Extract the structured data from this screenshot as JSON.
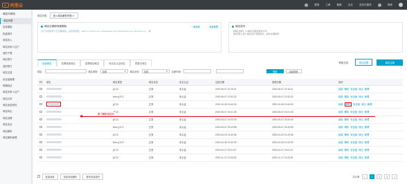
{
  "logo": {
    "text": "阿里云"
  },
  "topnav": [
    "费用",
    "工单",
    "备案",
    "企业",
    "支持与服务",
    "简体"
  ],
  "sidebar": {
    "header": "域名与网站",
    "items": [
      "域名列表",
      "信息模板",
      "批量操作",
      "域名转入",
      "域名持有人过户",
      "我的下载",
      "域名预订",
      "我的预订",
      "域名交易",
      "安全锁管理",
      "邮箱验证",
      "域名持有人过户",
      "域名共享",
      "域名信息修改",
      "域名转出",
      "域名设置",
      "域名安全",
      "域名解析",
      "域名解析管理"
    ]
  },
  "breadcrumb": {
    "current": "域名列表",
    "tab": "进入域名解析列表>>"
  },
  "notice": {
    "title": "域名过期即将被删除",
    "text": "以下为您账号下已过期域名，请及时续费：tauhu.cn  tauhu.com  ecloudtimes.com  baihuitimes.com  eknowb.com  ... 等",
    "link1": "一键续费",
    "link2": "续费管理"
  },
  "info": {
    "title": "域名资讯",
    "text": "【域名注册】.cn域名注册优惠进行中\n【新功能上线】域名过户流程优化，提升办理效率"
  },
  "tabs": [
    "全部域名",
    "急需续费域名",
    "急需赎回域名",
    "未实名认证域名",
    "预登记域名"
  ],
  "actions": {
    "help": "帮助文档",
    "export": "导出列表",
    "register": "域名注册"
  },
  "filters": {
    "label_domain": "域名:",
    "placeholder_domain": "",
    "label_type": "域名类型:",
    "type_value": "全部",
    "label_status": "域名状态:",
    "status_value": "全部",
    "label_expire": "注册时间:",
    "search": "搜索",
    "advanced": "高级搜索"
  },
  "table": {
    "headers": [
      "",
      "域名",
      "域名类型",
      "域名状态",
      "实名认证",
      "注册日期",
      "到期日期",
      "操作"
    ],
    "rows": [
      {
        "type": "gTLD",
        "status": "正常",
        "auth": "未认证",
        "reg": "2019-05-07 22:15:11",
        "exp": "2020-05-07 22:15:11"
      },
      {
        "type": "New gTLD",
        "status": "正常",
        "auth": "未认证",
        "reg": "2019-05-07 07:52:22",
        "exp": "2020-05-07 07:52:22"
      },
      {
        "type": "gTLD",
        "status": "正常",
        "auth": "未认证",
        "reg": "2019-10-28 13:44:00",
        "exp": "2020-10-28 13:44:00",
        "domain": "ST(xxx).cn"
      },
      {
        "type": "gTLD",
        "status": "正常",
        "auth": "未认证",
        "reg": "2019-05-07 20:21:35",
        "exp": "2020-05-07 20:21:35"
      },
      {
        "type": "gTLD",
        "status": "正常",
        "auth": "未认证",
        "reg": "2019-05-07 20:20:00",
        "exp": "2020-05-07 20:20:00"
      },
      {
        "type": "New gTLD",
        "status": "正常",
        "auth": "未认证",
        "reg": "2019-05-07 20:19:55",
        "exp": "2020-05-07 20:19:55"
      },
      {
        "type": "gTLD",
        "status": "正常",
        "auth": "未认证",
        "reg": "2019-04-29 21:43:06",
        "exp": "2020-04-29 21:43:06"
      },
      {
        "type": "New gTLD",
        "status": "正常",
        "auth": "未认证",
        "reg": "2019-04-28 21:43:32",
        "exp": "2020-04-28 21:43:32"
      },
      {
        "type": "gTLD",
        "status": "正常",
        "auth": "未认证",
        "reg": "2019-04-27 20:01:07",
        "exp": "2020-04-27 20:01:07"
      },
      {
        "type": "gTLD",
        "status": "正常",
        "auth": "未认证",
        "reg": "2019-11-17 21:05:20",
        "exp": "2020-11-17 21:05:20"
      }
    ],
    "ops": [
      "续费",
      "解析",
      "安全锁",
      "转出",
      "管理"
    ]
  },
  "annotation": {
    "text": "单个解析添加字"
  },
  "footer": {
    "batch_renew": "批量续费",
    "batch_resolve": "批量添加解析",
    "more": "更多批量操作",
    "pages": [
      "<",
      "1",
      "2",
      "3",
      ">"
    ],
    "total": "共10条"
  },
  "colors": {
    "accent": "#00a2ca",
    "brand": "#ff6a00",
    "annotation": "#e60012",
    "topbar": "#373d41"
  }
}
